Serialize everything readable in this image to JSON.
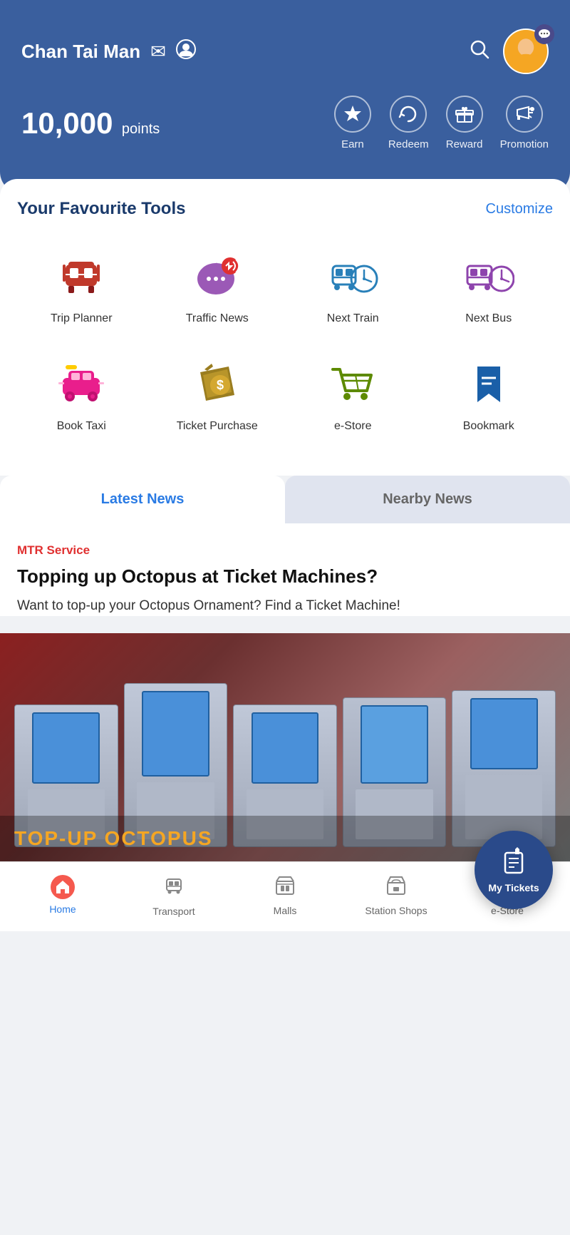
{
  "header": {
    "user_name": "Chan Tai Man",
    "points": "10,000",
    "points_label": "points",
    "search_icon": "🔍",
    "message_icon": "✉",
    "profile_icon": "👤",
    "chat_icon": "💬"
  },
  "quick_actions": [
    {
      "id": "earn",
      "label": "Earn",
      "icon": "⭐"
    },
    {
      "id": "redeem",
      "label": "Redeem",
      "icon": "🔄"
    },
    {
      "id": "reward",
      "label": "Reward",
      "icon": "🎁"
    },
    {
      "id": "promotion",
      "label": "Promotion",
      "icon": "📣"
    }
  ],
  "tools_section": {
    "title": "Your Favourite Tools",
    "customize_label": "Customize"
  },
  "tools": [
    {
      "id": "trip-planner",
      "label": "Trip Planner",
      "color": "#c0392b"
    },
    {
      "id": "traffic-news",
      "label": "Traffic News",
      "color": "#9b59b6"
    },
    {
      "id": "next-train",
      "label": "Next Train",
      "color": "#2980b9"
    },
    {
      "id": "next-bus",
      "label": "Next Bus",
      "color": "#8e44ad"
    },
    {
      "id": "book-taxi",
      "label": "Book Taxi",
      "color": "#e91e8c"
    },
    {
      "id": "ticket-purchase",
      "label": "Ticket Purchase",
      "color": "#7d6608"
    },
    {
      "id": "e-store",
      "label": "e-Store",
      "color": "#5d8a00"
    },
    {
      "id": "bookmark",
      "label": "Bookmark",
      "color": "#1a5fa8"
    }
  ],
  "news_tabs": [
    {
      "id": "latest",
      "label": "Latest News",
      "active": true
    },
    {
      "id": "nearby",
      "label": "Nearby News",
      "active": false
    }
  ],
  "news": {
    "category": "MTR Service",
    "title": "Topping up Octopus at Ticket Machines?",
    "subtitle": "Want to top-up your Octopus Ornament? Find a Ticket Machine!",
    "image_text": "TOP-UP OCTOPUS"
  },
  "bottom_nav": [
    {
      "id": "home",
      "label": "Home",
      "active": true
    },
    {
      "id": "transport",
      "label": "Transport",
      "active": false
    },
    {
      "id": "malls",
      "label": "Malls",
      "active": false
    },
    {
      "id": "station-shops",
      "label": "Station Shops",
      "active": false
    },
    {
      "id": "e-store",
      "label": "e-Store",
      "active": false
    }
  ],
  "fab": {
    "label": "My Tickets"
  }
}
